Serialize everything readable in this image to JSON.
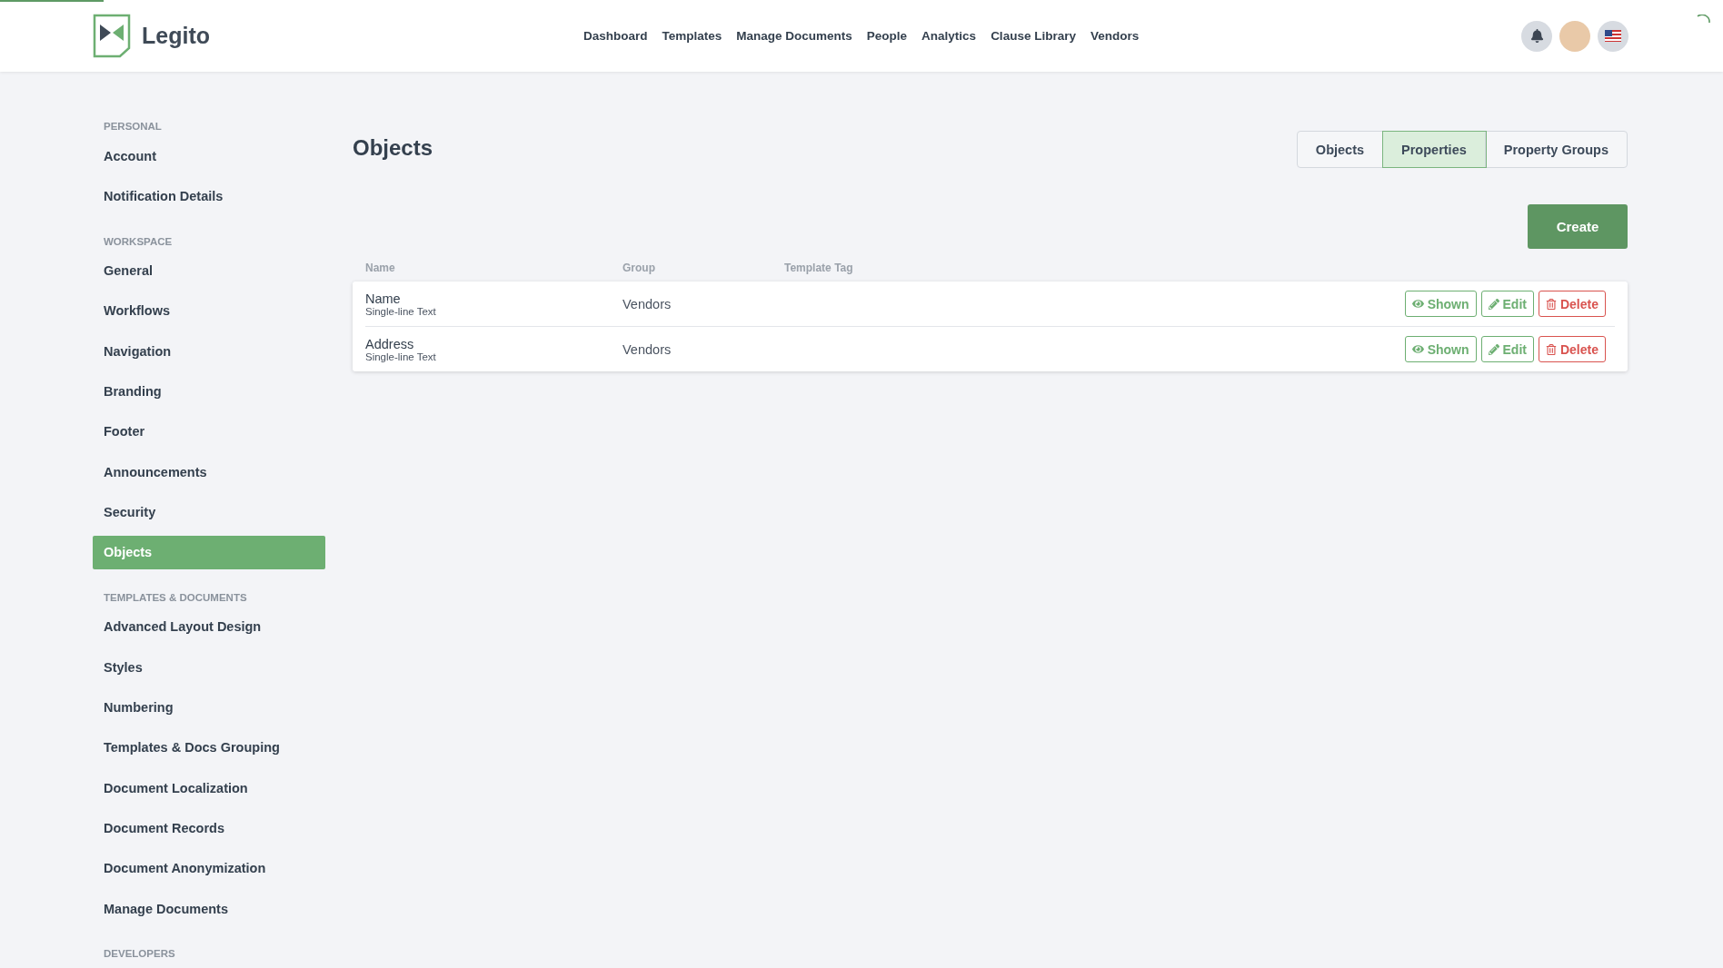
{
  "header": {
    "logo_text": "Legito",
    "nav": [
      "Dashboard",
      "Templates",
      "Manage Documents",
      "People",
      "Analytics",
      "Clause Library",
      "Vendors"
    ]
  },
  "sidebar": {
    "sections": [
      {
        "heading": "PERSONAL",
        "items": [
          {
            "label": "Account",
            "selected": false
          },
          {
            "label": "Notification Details",
            "selected": false
          }
        ]
      },
      {
        "heading": "WORKSPACE",
        "items": [
          {
            "label": "General",
            "selected": false
          },
          {
            "label": "Workflows",
            "selected": false
          },
          {
            "label": "Navigation",
            "selected": false
          },
          {
            "label": "Branding",
            "selected": false
          },
          {
            "label": "Footer",
            "selected": false
          },
          {
            "label": "Announcements",
            "selected": false
          },
          {
            "label": "Security",
            "selected": false
          },
          {
            "label": "Objects",
            "selected": true
          }
        ]
      },
      {
        "heading": "TEMPLATES & DOCUMENTS",
        "items": [
          {
            "label": "Advanced Layout Design",
            "selected": false
          },
          {
            "label": "Styles",
            "selected": false
          },
          {
            "label": "Numbering",
            "selected": false
          },
          {
            "label": "Templates & Docs Grouping",
            "selected": false
          },
          {
            "label": "Document Localization",
            "selected": false
          },
          {
            "label": "Document Records",
            "selected": false
          },
          {
            "label": "Document Anonymization",
            "selected": false
          },
          {
            "label": "Manage Documents",
            "selected": false
          }
        ]
      },
      {
        "heading": "DEVELOPERS"
      }
    ]
  },
  "loading": {
    "level": 0.06
  },
  "page": {
    "title": "Objects",
    "tabs": [
      {
        "label": "Objects",
        "selected": false
      },
      {
        "label": "Properties",
        "selected": true
      },
      {
        "label": "Property Groups",
        "selected": false
      }
    ],
    "create_button": "Create"
  },
  "table": {
    "columns": [
      "Name",
      "Group",
      "Template Tag"
    ],
    "rows": [
      {
        "name": "Name",
        "type": "Single-line Text",
        "group": "Vendors",
        "shown": "Shown",
        "edit": "Edit",
        "delete": "Delete"
      },
      {
        "name": "Address",
        "type": "Single-line Text",
        "group": "Vendors",
        "shown": "Shown",
        "edit": "Edit",
        "delete": "Delete"
      }
    ]
  }
}
